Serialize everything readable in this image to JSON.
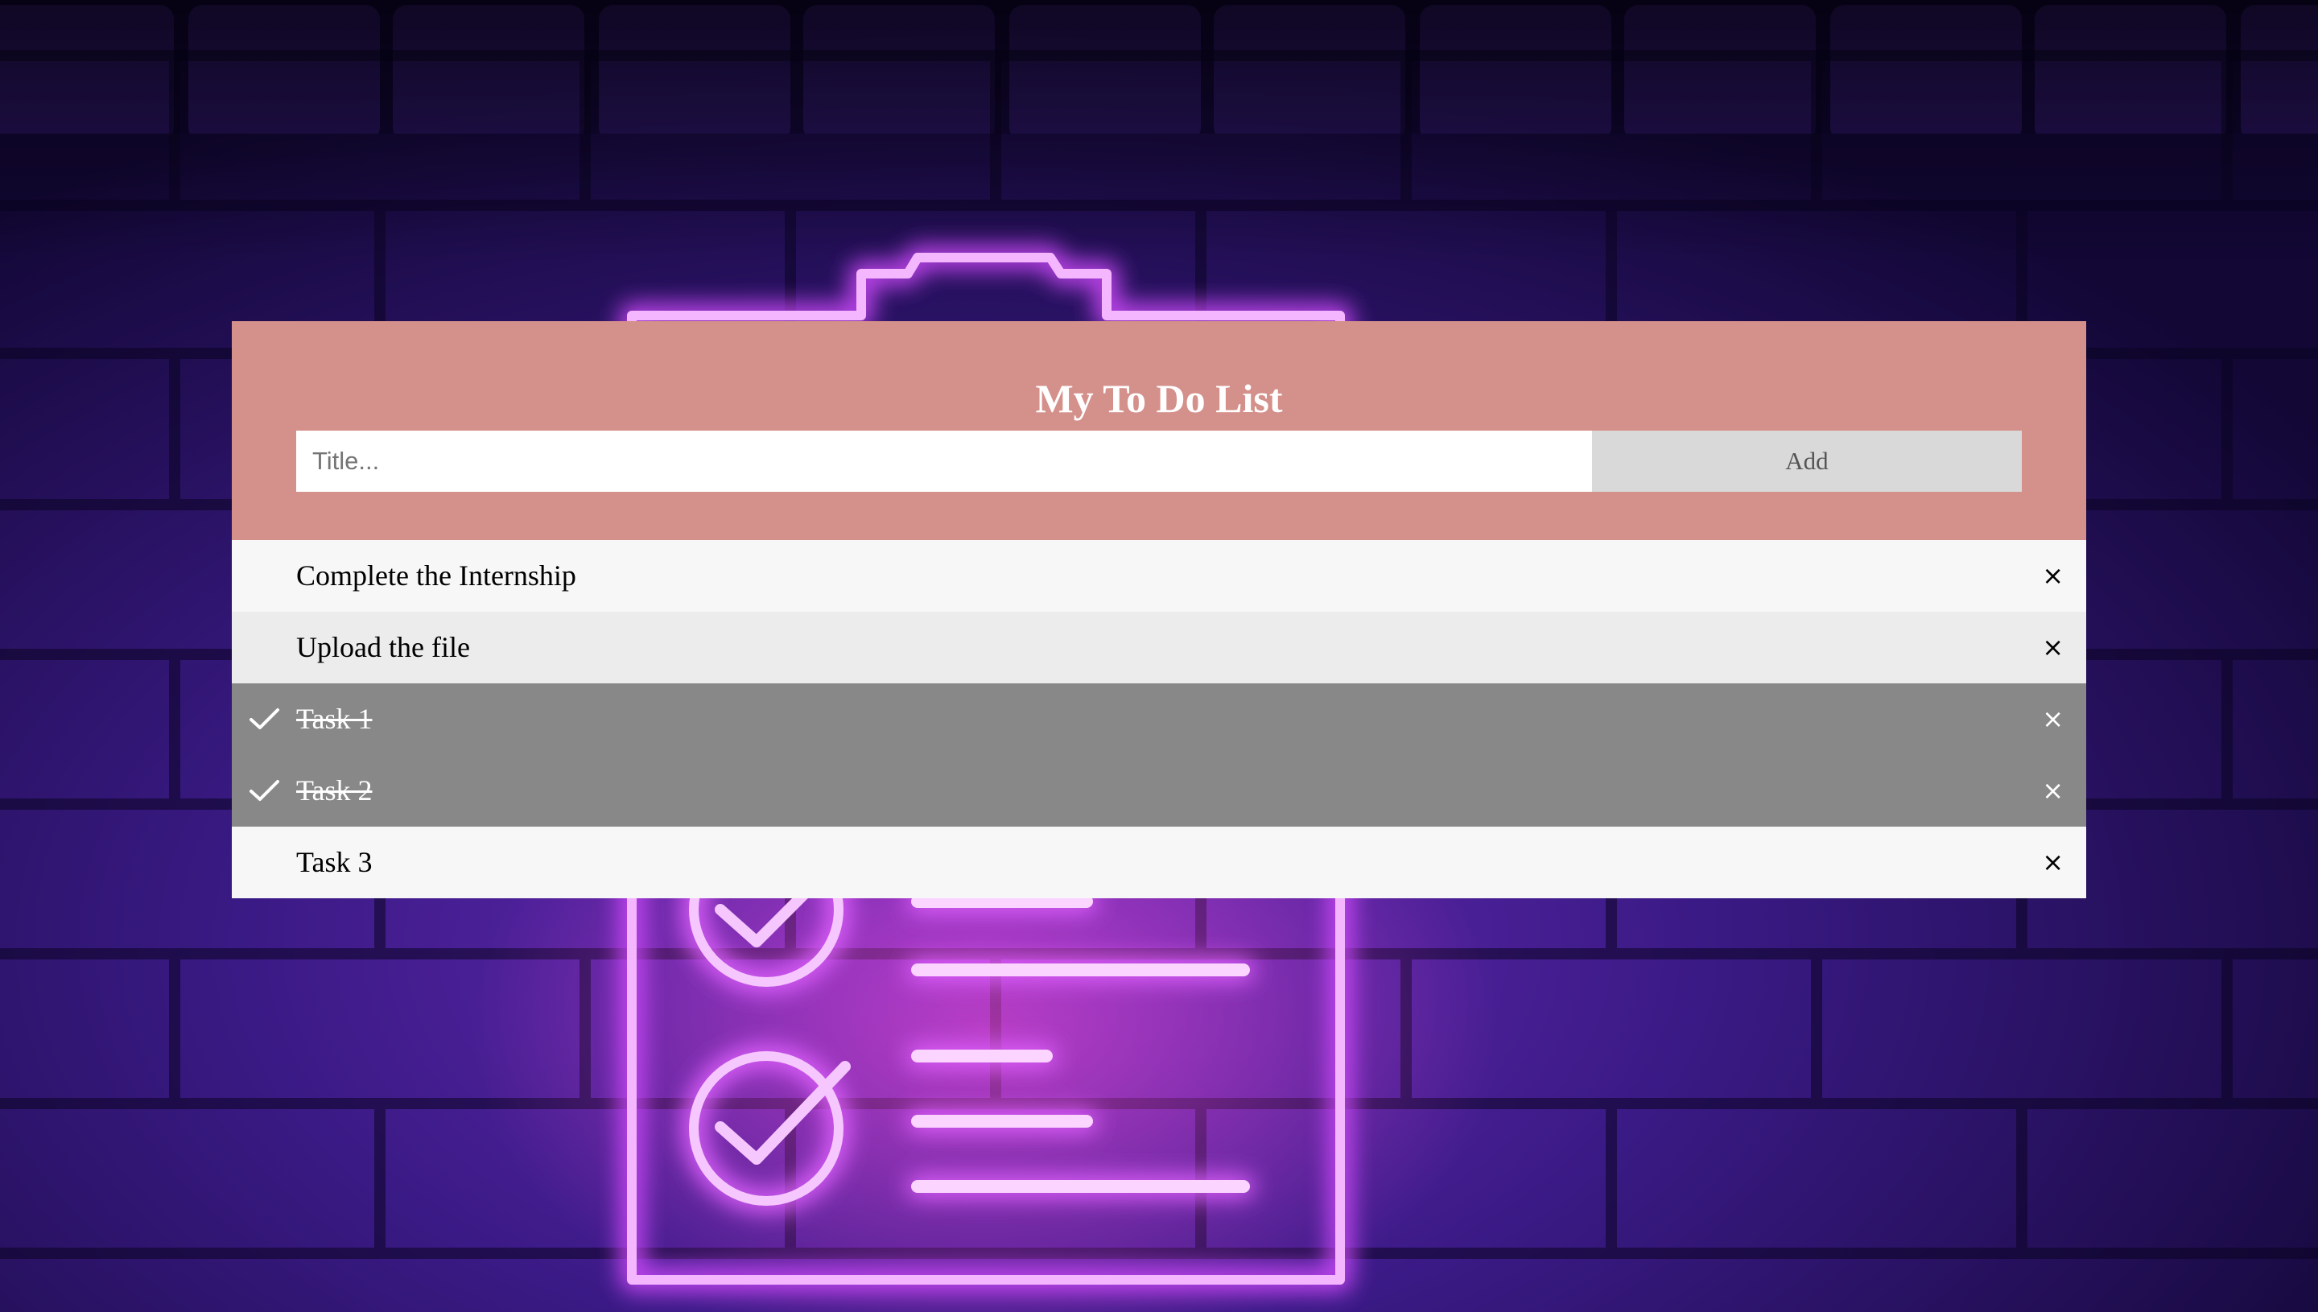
{
  "app": {
    "title": "My To Do List"
  },
  "form": {
    "input_placeholder": "Title...",
    "input_value": "",
    "add_label": "Add"
  },
  "tasks": [
    {
      "label": "Complete the Internship",
      "checked": false,
      "close": "×"
    },
    {
      "label": "Upload the file",
      "checked": false,
      "close": "×"
    },
    {
      "label": "Task 1",
      "checked": true,
      "close": "×"
    },
    {
      "label": "Task 2",
      "checked": true,
      "close": "×"
    },
    {
      "label": "Task 3",
      "checked": false,
      "close": "×"
    }
  ],
  "colors": {
    "header": "#d4908a",
    "checked_row": "#888888",
    "row_odd": "#f7f7f7",
    "row_even": "#ececec",
    "add_button": "#d9d9d9",
    "wall": "#2a1460",
    "neon_pink": "#f07af0",
    "neon_violet": "#9b5cff"
  },
  "background": {
    "subject": "neon-clipboard-checklist-on-brick-wall",
    "icons": [
      "clipboard-icon",
      "checkmark-circle-icon"
    ]
  }
}
